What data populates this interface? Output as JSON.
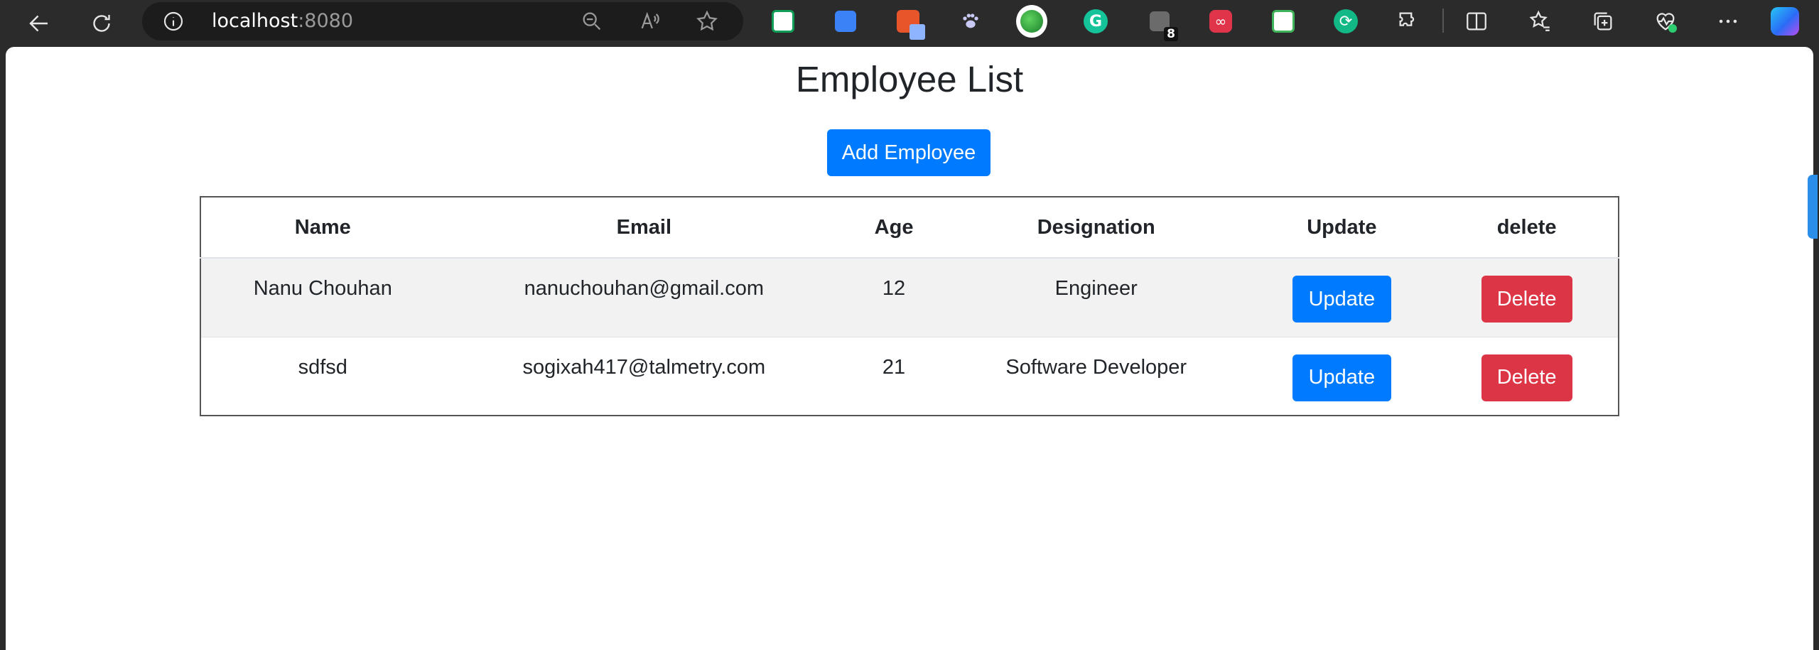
{
  "browser": {
    "url_host": "localhost",
    "url_port": ":8080",
    "extension_badge": "8",
    "icons": [
      "back-arrow-icon",
      "refresh-icon",
      "info-icon",
      "zoom-out-icon",
      "read-aloud-icon",
      "favorite-star-icon",
      "split-screen-icon",
      "favorites-icon",
      "collections-icon",
      "performance-icon",
      "more-menu-icon",
      "copilot-icon"
    ],
    "colors": {
      "chrome": "#2b2b2b",
      "address_bar": "#1c1c1c"
    }
  },
  "page": {
    "title": "Employee List",
    "add_button": "Add Employee",
    "table": {
      "headers": [
        "Name",
        "Email",
        "Age",
        "Designation",
        "Update",
        "delete"
      ],
      "rows": [
        {
          "name": "Nanu Chouhan",
          "email": "nanuchouhan@gmail.com",
          "age": "12",
          "designation": "Engineer",
          "update": "Update",
          "delete": "Delete"
        },
        {
          "name": "sdfsd",
          "email": "sogixah417@talmetry.com",
          "age": "21",
          "designation": "Software Developer",
          "update": "Update",
          "delete": "Delete"
        }
      ]
    },
    "colors": {
      "primary": "#007bff",
      "danger": "#dc3545",
      "striped_row": "#f2f2f2"
    }
  }
}
